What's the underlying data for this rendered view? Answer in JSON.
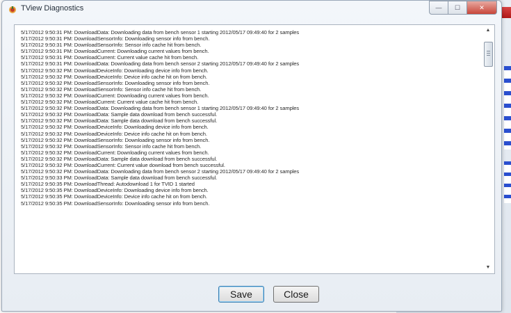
{
  "window": {
    "title": "TView Diagnostics",
    "controls": {
      "minimize": "—",
      "maximize": "☐",
      "close": "✕"
    }
  },
  "log": {
    "lines": [
      "5/17/2012 9:50:31 PM: DownloadData: Downloading data from bench sensor 1 starting 2012/05/17 09:49:40 for 2 samples",
      "5/17/2012 9:50:31 PM: DownloadSensorInfo: Downloading sensor info from bench.",
      "5/17/2012 9:50:31 PM: DownloadSensorInfo: Sensor info cache hit from bench.",
      "5/17/2012 9:50:31 PM: DownloadCurrent: Downloading current values from bench.",
      "5/17/2012 9:50:31 PM: DownloadCurrent: Current value cache hit from bench.",
      "5/17/2012 9:50:31 PM: DownloadData: Downloading data from bench sensor 2 starting 2012/05/17 09:49:40 for 2 samples",
      "5/17/2012 9:50:32 PM: DownloadDeviceInfo: Downloading device info from bench.",
      "5/17/2012 9:50:32 PM: DownloadDeviceInfo: Device info cache hit on from bench.",
      "5/17/2012 9:50:32 PM: DownloadSensorInfo: Downloading sensor info from bench.",
      "5/17/2012 9:50:32 PM: DownloadSensorInfo: Sensor info cache hit from bench.",
      "5/17/2012 9:50:32 PM: DownloadCurrent: Downloading current values from bench.",
      "5/17/2012 9:50:32 PM: DownloadCurrent: Current value cache hit from bench.",
      "5/17/2012 9:50:32 PM: DownloadData: Downloading data from bench sensor 1 starting 2012/05/17 09:49:40 for 2 samples",
      "5/17/2012 9:50:32 PM: DownloadData: Sample data download from bench successful.",
      "5/17/2012 9:50:32 PM: DownloadData: Sample data download from bench successful.",
      "5/17/2012 9:50:32 PM: DownloadDeviceInfo: Downloading device info from bench.",
      "5/17/2012 9:50:32 PM: DownloadDeviceInfo: Device info cache hit on from bench.",
      "5/17/2012 9:50:32 PM: DownloadSensorInfo: Downloading sensor info from bench.",
      "5/17/2012 9:50:32 PM: DownloadSensorInfo: Sensor info cache hit from bench.",
      "5/17/2012 9:50:32 PM: DownloadCurrent: Downloading current values from bench.",
      "5/17/2012 9:50:32 PM: DownloadData: Sample data download from bench successful.",
      "5/17/2012 9:50:32 PM: DownloadCurrent: Current value download from bench successful.",
      "5/17/2012 9:50:32 PM: DownloadData: Downloading data from bench sensor 2 starting 2012/05/17 09:49:40 for 2 samples",
      "5/17/2012 9:50:33 PM: DownloadData: Sample data download from bench successful.",
      "5/17/2012 9:50:35 PM: DownloadThread: Autodownload 1 for TVID 1 started",
      "5/17/2012 9:50:35 PM: DownloadDeviceInfo: Downloading device info from bench.",
      "5/17/2012 9:50:35 PM: DownloadDeviceInfo: Device info cache hit on from bench.",
      "5/17/2012 9:50:35 PM: DownloadSensorInfo: Downloading sensor info from bench."
    ]
  },
  "buttons": {
    "save": "Save",
    "close": "Close"
  },
  "scrollbar": {
    "up": "▲",
    "down": "▼"
  }
}
